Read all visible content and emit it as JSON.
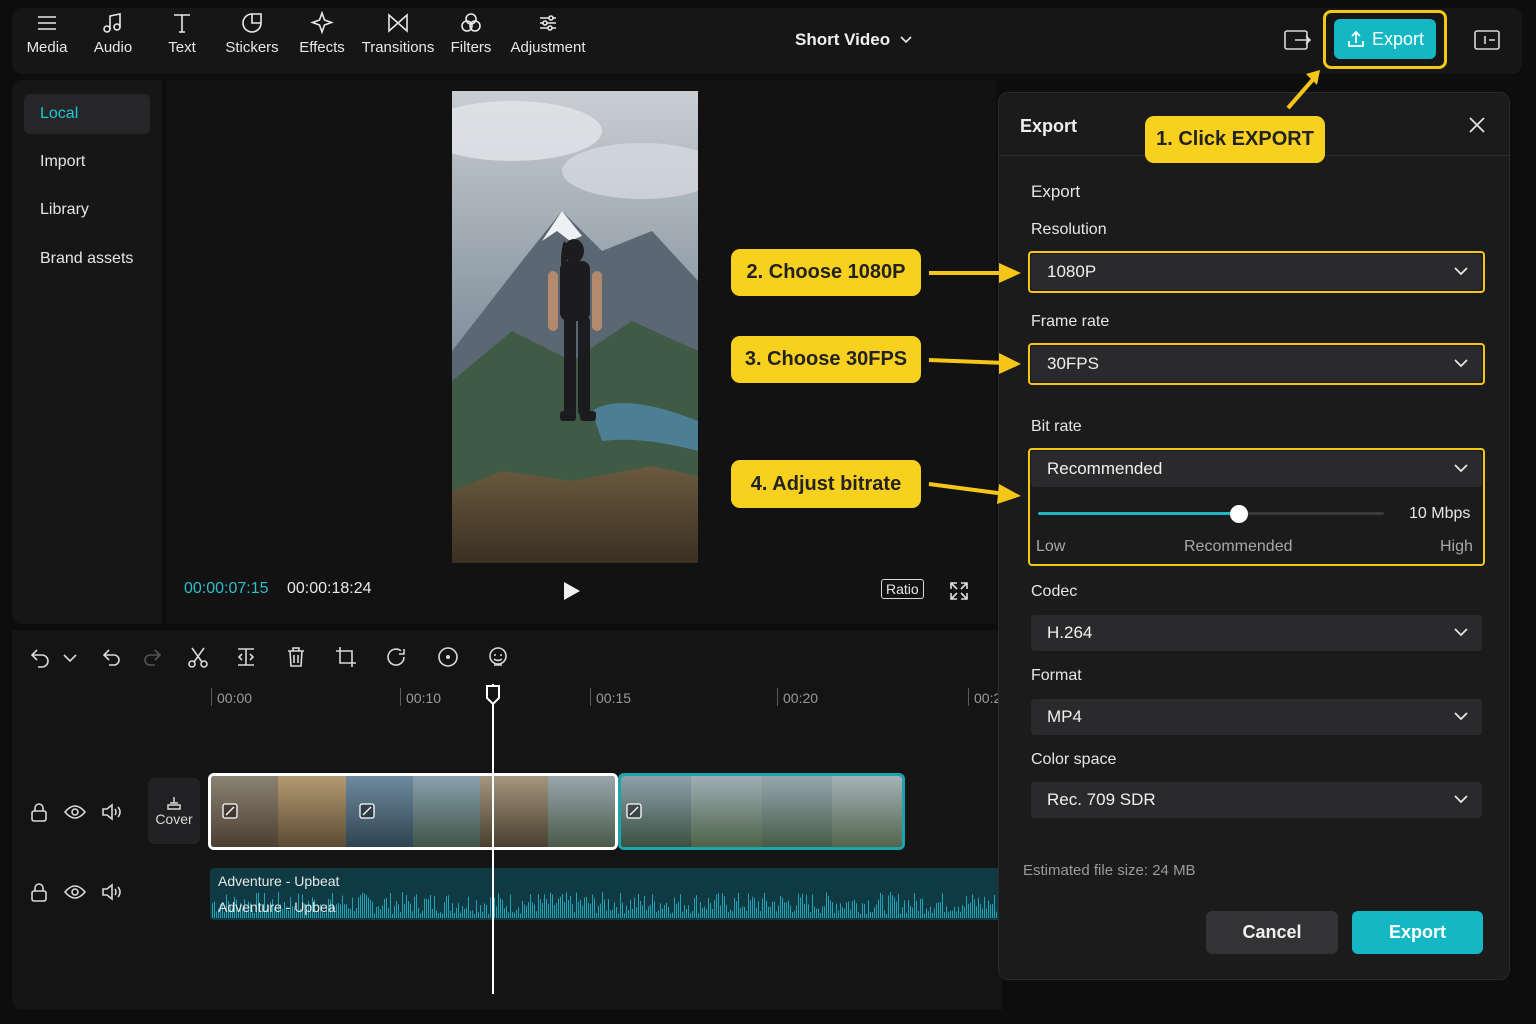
{
  "toolbar": {
    "items": [
      {
        "label": "Media",
        "icon": "menu-icon"
      },
      {
        "label": "Audio",
        "icon": "music-note-icon"
      },
      {
        "label": "Text",
        "icon": "text-icon"
      },
      {
        "label": "Stickers",
        "icon": "sticker-icon"
      },
      {
        "label": "Effects",
        "icon": "sparkle-icon"
      },
      {
        "label": "Transitions",
        "icon": "bowtie-icon"
      },
      {
        "label": "Filters",
        "icon": "filter-icon"
      },
      {
        "label": "Adjustment",
        "icon": "sliders-icon"
      }
    ],
    "project_title": "Short Video",
    "export_label": "Export"
  },
  "sidebar": {
    "items": [
      {
        "label": "Local",
        "active": true
      },
      {
        "label": "Import"
      },
      {
        "label": "Library"
      },
      {
        "label": "Brand assets"
      }
    ]
  },
  "player": {
    "current_time": "00:00:07:15",
    "total_time": "00:00:18:24",
    "ratio_label": "Ratio"
  },
  "timeline": {
    "ticks": [
      "00:00",
      "00:10",
      "00:15",
      "00:20",
      "00:2"
    ],
    "cover_label": "Cover",
    "audio_clip_label": "Adventure - Upbeat",
    "audio_clip_label_2": "Adventure - Upbea"
  },
  "export_dialog": {
    "title": "Export",
    "section": "Export",
    "resolution_label": "Resolution",
    "resolution_value": "1080P",
    "frame_rate_label": "Frame rate",
    "frame_rate_value": "30FPS",
    "bit_rate_label": "Bit rate",
    "bit_rate_value": "Recommended",
    "bit_rate_mbps": "10 Mbps",
    "bit_rate_level": 0.58,
    "scale_low": "Low",
    "scale_mid": "Recommended",
    "scale_high": "High",
    "codec_label": "Codec",
    "codec_value": "H.264",
    "format_label": "Format",
    "format_value": "MP4",
    "color_space_label": "Color space",
    "color_space_value": "Rec. 709 SDR",
    "file_size": "Estimated file size: 24 MB",
    "cancel_label": "Cancel",
    "export_label": "Export"
  },
  "callouts": {
    "step1": "1. Click EXPORT",
    "step2": "2. Choose 1080P",
    "step3": "3. Choose 30FPS",
    "step4": "4. Adjust bitrate"
  },
  "colors": {
    "accent": "#14b8c4",
    "highlight": "#f5c518",
    "callout": "#f7d11e"
  }
}
